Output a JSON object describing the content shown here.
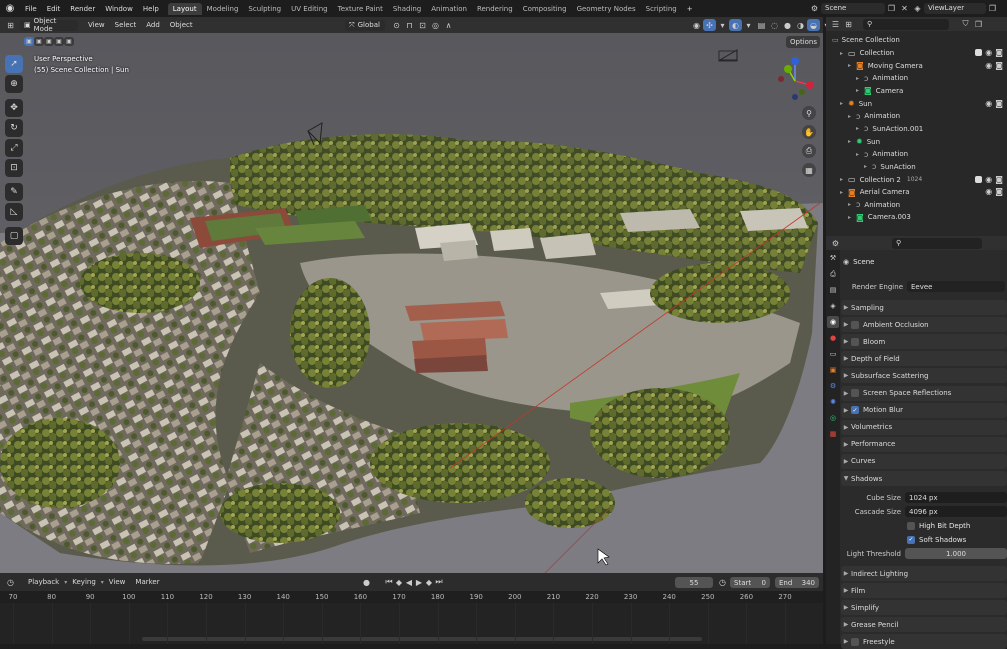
{
  "topbar": {
    "menus": [
      "File",
      "Edit",
      "Render",
      "Window",
      "Help"
    ],
    "workspaces": [
      "Layout",
      "Modeling",
      "Sculpting",
      "UV Editing",
      "Texture Paint",
      "Shading",
      "Animation",
      "Rendering",
      "Compositing",
      "Geometry Nodes",
      "Scripting"
    ],
    "active_workspace": "Layout",
    "add_tab": "+",
    "scene": "Scene",
    "view_layer": "ViewLayer"
  },
  "viewport_header": {
    "mode": "Object Mode",
    "menus": [
      "View",
      "Select",
      "Add",
      "Object"
    ],
    "orientation": "Global",
    "options": "Options"
  },
  "viewport": {
    "view_name": "User Perspective",
    "view_info": "(55) Scene Collection | Sun"
  },
  "outliner": {
    "root": "Scene Collection",
    "rows": [
      {
        "label": "Collection",
        "indent": 1,
        "icon": "collection-icon",
        "checkbox": true
      },
      {
        "label": "Moving Camera",
        "indent": 2,
        "icon": "camera-object-icon",
        "eye": true
      },
      {
        "label": "Animation",
        "indent": 3,
        "icon": "action-icon"
      },
      {
        "label": "Camera",
        "indent": 3,
        "icon": "camera-data-icon"
      },
      {
        "label": "Sun",
        "indent": 1,
        "icon": "light-object-icon",
        "eye": true
      },
      {
        "label": "Animation",
        "indent": 2,
        "icon": "action-icon"
      },
      {
        "label": "SunAction.001",
        "indent": 3,
        "icon": "action-icon"
      },
      {
        "label": "Sun",
        "indent": 2,
        "icon": "light-data-icon"
      },
      {
        "label": "Animation",
        "indent": 3,
        "icon": "action-icon"
      },
      {
        "label": "SunAction",
        "indent": 4,
        "icon": "action-icon"
      },
      {
        "label": "Collection 2",
        "indent": 1,
        "icon": "collection-icon",
        "checkbox": true,
        "badge": "1024"
      },
      {
        "label": "Aerial Camera",
        "indent": 1,
        "icon": "camera-object-icon",
        "eye": true
      },
      {
        "label": "Animation",
        "indent": 2,
        "icon": "action-icon"
      },
      {
        "label": "Camera.003",
        "indent": 2,
        "icon": "camera-data-icon"
      }
    ]
  },
  "properties": {
    "context": "Scene",
    "render_engine_label": "Render Engine",
    "render_engine": "Eevee",
    "panels_top": [
      {
        "label": "Sampling"
      },
      {
        "label": "Ambient Occlusion",
        "checkbox": false
      },
      {
        "label": "Bloom",
        "checkbox": false
      },
      {
        "label": "Depth of Field"
      },
      {
        "label": "Subsurface Scattering"
      },
      {
        "label": "Screen Space Reflections",
        "checkbox": false
      },
      {
        "label": "Motion Blur",
        "checkbox": true
      },
      {
        "label": "Volumetrics"
      },
      {
        "label": "Performance"
      },
      {
        "label": "Curves"
      }
    ],
    "shadows": {
      "label": "Shadows",
      "cube_size_label": "Cube Size",
      "cube_size": "1024 px",
      "cascade_size_label": "Cascade Size",
      "cascade_size": "4096 px",
      "high_bit_depth": "High Bit Depth",
      "soft_shadows": "Soft Shadows",
      "light_threshold_label": "Light Threshold",
      "light_threshold": "1.000"
    },
    "panels_bottom": [
      {
        "label": "Indirect Lighting"
      },
      {
        "label": "Film"
      },
      {
        "label": "Simplify"
      },
      {
        "label": "Grease Pencil"
      },
      {
        "label": "Freestyle",
        "checkbox": false
      }
    ]
  },
  "timeline": {
    "menus": [
      "Playback",
      "Keying",
      "View",
      "Marker"
    ],
    "current_frame": "55",
    "start_label": "Start",
    "start": "0",
    "end_label": "End",
    "end": "340",
    "ticks": [
      "70",
      "80",
      "90",
      "100",
      "110",
      "120",
      "130",
      "140",
      "150",
      "160",
      "170",
      "180",
      "190",
      "200",
      "210",
      "220",
      "230",
      "240",
      "250",
      "260",
      "270"
    ]
  },
  "colors": {
    "accent": "#4772b3",
    "header": "#303030",
    "panel": "#333333",
    "ground": "#7a7a7f"
  }
}
